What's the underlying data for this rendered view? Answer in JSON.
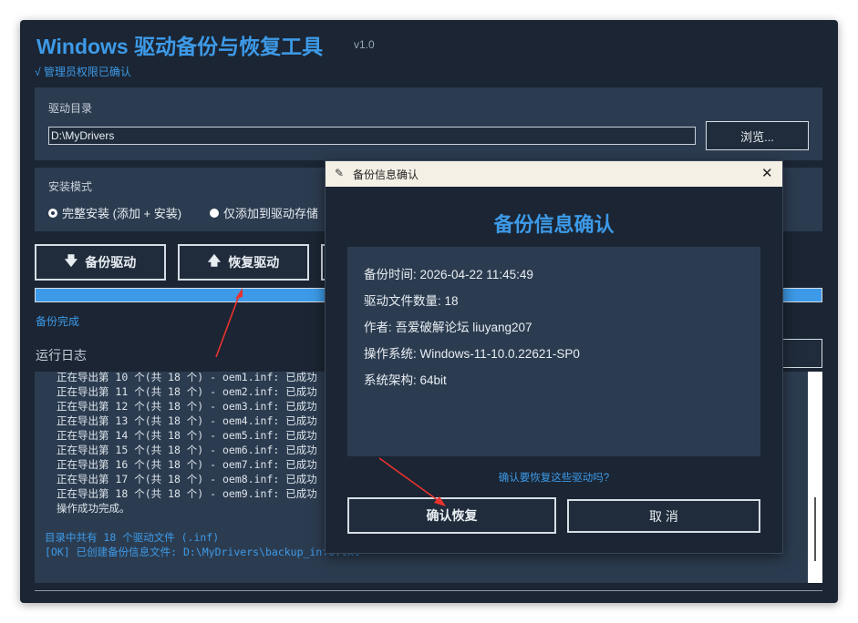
{
  "app": {
    "title": "Windows 驱动备份与恢复工具",
    "version": "v1.0",
    "admin_status": "√ 管理员权限已确认"
  },
  "driver_dir": {
    "label": "驱动目录",
    "value": "D:\\MyDrivers",
    "browse_label": "浏览..."
  },
  "install_mode": {
    "label": "安装模式",
    "options": [
      {
        "label": "完整安装 (添加 + 安装)",
        "selected": true
      },
      {
        "label": "仅添加到驱动存储",
        "selected": false
      }
    ]
  },
  "actions": {
    "backup_label": "备份驱动",
    "restore_label": "恢复驱动",
    "backup_icon": "arrow-down-icon",
    "restore_icon": "arrow-up-icon"
  },
  "progress": {
    "value": 1.0,
    "status": "备份完成"
  },
  "log": {
    "label": "运行日志",
    "lines": [
      "正在导出第 10 个(共 18 个) - oem1.inf: 已成功",
      "正在导出第 11 个(共 18 个) - oem2.inf: 已成功",
      "正在导出第 12 个(共 18 个) - oem3.inf: 已成功",
      "正在导出第 13 个(共 18 个) - oem4.inf: 已成功",
      "正在导出第 14 个(共 18 个) - oem5.inf: 已成功",
      "正在导出第 15 个(共 18 个) - oem6.inf: 已成功",
      "正在导出第 16 个(共 18 个) - oem7.inf: 已成功",
      "正在导出第 17 个(共 18 个) - oem8.inf: 已成功",
      "正在导出第 18 个(共 18 个) - oem9.inf: 已成功",
      "操作成功完成。"
    ],
    "summary_lines": [
      "目录中共有 18 个驱动文件 (.inf)",
      "[OK] 已创建备份信息文件: D:\\MyDrivers\\backup_info.txt"
    ]
  },
  "dialog": {
    "window_title": "备份信息确认",
    "title_icon": "feather-icon",
    "close_glyph": "✕",
    "heading": "备份信息确认",
    "info": [
      "备份时间: 2026-04-22 11:45:49",
      "驱动文件数量: 18",
      "作者: 吾爱破解论坛  liuyang207",
      "操作系统: Windows-11-10.0.22621-SP0",
      "系统架构: 64bit"
    ],
    "question": "确认要恢复这些驱动吗?",
    "confirm_label": "确认恢复",
    "cancel_label": "取 消"
  },
  "colors": {
    "accent": "#3d9ae8",
    "window_bg": "#1b2533",
    "panel_bg": "#2c3c50",
    "annotation_arrow": "#e8322e"
  }
}
